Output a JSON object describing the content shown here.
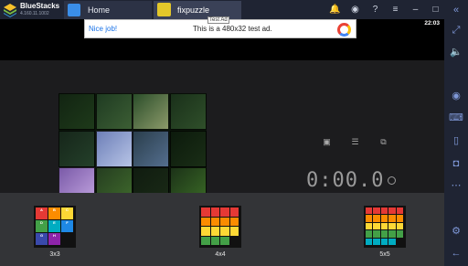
{
  "titlebar": {
    "brand_name": "BlueStacks",
    "brand_version": "4.160.11.1002",
    "tabs": [
      {
        "label": "Home",
        "icon": "home-icon"
      },
      {
        "label": "fixpuzzle",
        "icon": "puzzle-app-icon"
      }
    ],
    "icons": [
      "bell-icon",
      "account-icon",
      "help-icon",
      "menu-icon",
      "minimize-icon",
      "maximize-icon",
      "close-icon"
    ]
  },
  "status_bar": {
    "time": "22:03"
  },
  "ad": {
    "badge": "Test Ad",
    "nice": "Nice job!",
    "text": "This is a 480x32 test ad."
  },
  "game": {
    "timer": "0:00.0",
    "controls": [
      "picture-preview-icon",
      "list-icon",
      "gallery-icon"
    ],
    "sizes": [
      {
        "label": "3x3",
        "letters": [
          "A",
          "B",
          "C",
          "D",
          "E",
          "F",
          "G",
          "H"
        ],
        "colors": [
          "#e53935",
          "#fb8c00",
          "#fdd835",
          "#43a047",
          "#00acc1",
          "#1e88e5",
          "#3949ab",
          "#8e24aa",
          "#111111"
        ]
      },
      {
        "label": "4x4"
      },
      {
        "label": "5x5"
      }
    ]
  },
  "sidebar": {
    "icons": [
      "collapse-icon",
      "fullscreen-icon",
      "volume-icon",
      "eye-icon",
      "keyboard-icon",
      "phone-rotate-icon",
      "camera-icon",
      "more-icon",
      "settings-icon",
      "back-icon"
    ]
  }
}
